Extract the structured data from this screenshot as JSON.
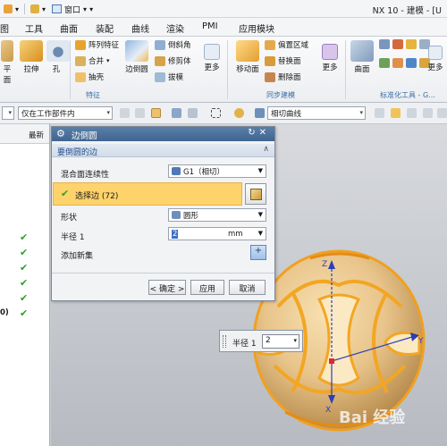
{
  "app": {
    "title": "NX 10 - 建模 - [U",
    "window_menu": "窗口",
    "dropdown_glyph": "▾"
  },
  "menu_tabs": [
    "图",
    "工具",
    "曲面",
    "装配",
    "曲线",
    "渲染",
    "PMI",
    "应用模块"
  ],
  "ribbon": {
    "partial_left": "平面",
    "extrude": "拉伸",
    "hole": "孔",
    "pattern_feature": "阵列特征",
    "unite": "合并",
    "shell": "抽壳",
    "edge_blend": "边倒圆",
    "chamfer": "倒斜角",
    "trim_body": "修剪体",
    "draft": "拔模",
    "more1": "更多",
    "feature_group": "特征",
    "move_face": "移动面",
    "offset_region": "偏置区域",
    "replace_face": "替换面",
    "delete_face": "删除面",
    "more2": "更多",
    "sync_group": "同步建模",
    "surface": "曲面",
    "more3": "更多",
    "std_tools_group": "标准化工具 - G..."
  },
  "toolbar": {
    "selection_scope": "仅在工作部件内",
    "curve_rule": "相切曲线"
  },
  "navigator": {
    "column_latest": "最新",
    "row_prefix": "0)"
  },
  "dialog": {
    "title": "边倒圆",
    "section_edges": "要倒圆的边",
    "blend_continuity_label": "混合面连续性",
    "blend_continuity_value": "G1（相切）",
    "select_edge": "选择边 (72)",
    "shape_label": "形状",
    "shape_value": "圆形",
    "radius_label": "半径 1",
    "radius_value": "2",
    "radius_unit": "mm",
    "add_new_set": "添加新集",
    "ok": "< 确定 >",
    "apply": "应用",
    "cancel": "取消"
  },
  "viewport": {
    "float_label": "半径 1",
    "float_value": "2",
    "axis_z": "Z",
    "axis_x": "X",
    "watermark": "Bai 经验"
  },
  "colors": {
    "accent": "#3f6590",
    "selection_yellow": "#ffd36b",
    "model_orange": "#f0a020",
    "check_green": "#2ea02e"
  }
}
